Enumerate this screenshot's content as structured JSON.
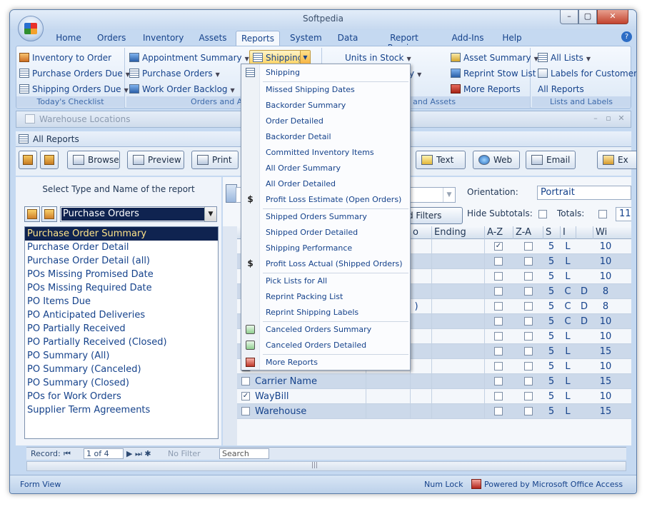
{
  "window": {
    "title": "Softpedia"
  },
  "tabs": [
    "Home",
    "Orders",
    "Inventory",
    "Assets",
    "Reports",
    "System",
    "Data",
    "Report Preview",
    "Add-Ins",
    "Help"
  ],
  "ribbon": {
    "g1": {
      "items": [
        "Inventory to Order",
        "Purchase Orders Due",
        "Shipping Orders Due"
      ],
      "label": "Today's Checklist"
    },
    "g2": {
      "items": [
        "Appointment Summary",
        "Purchase Orders",
        "Work Order Backlog"
      ],
      "label": "Orders and Appo"
    },
    "shipping_button": "Shipping",
    "g3": {
      "items": [
        "Units in Stock",
        "Asset Summary",
        "mary",
        "Reprint Stow List",
        "More Reports"
      ],
      "label": "ory and Assets"
    },
    "g4": {
      "items": [
        "All Lists",
        "Labels for Customers",
        "All Reports"
      ],
      "label": "Lists and Labels"
    }
  },
  "docwins": {
    "warehouse": "Warehouse Locations",
    "allreports": "All Reports"
  },
  "toolbar": {
    "browse": "Browse",
    "preview": "Preview",
    "print": "Print",
    "text": "Text",
    "web": "Web",
    "email": "Email",
    "exit": "Ex"
  },
  "leftpane": {
    "title": "Select Type and Name of the report",
    "selected_type": "Purchase Orders",
    "reports": [
      "Purchase Order Summary",
      "Purchase Order Detail",
      "Purchase Order Detail (all)",
      "POs Missing Promised Date",
      "POs Missing Required Date",
      "PO Items Due",
      "PO Anticipated Deliveries",
      "PO Partially Received",
      "PO Partially Received (Closed)",
      "PO Summary (All)",
      "PO Summary (Canceled)",
      "PO Summary (Closed)",
      "POs for Work Orders",
      "Supplier Term Agreements"
    ]
  },
  "options": {
    "orientation_label": "Orientation:",
    "orientation_value": "Portrait",
    "hide_subtotals_label": "Hide Subtotals:",
    "totals_label": "Totals:",
    "totals_value": "11",
    "filters_label": "d Filters"
  },
  "grid": {
    "headers": [
      "o",
      "Ending",
      "A-Z",
      "Z-A",
      "S",
      "I",
      "Wi"
    ],
    "rows": [
      {
        "name": "",
        "az": true,
        "s": "5",
        "i": "L",
        "d": "",
        "w": "10"
      },
      {
        "name": "",
        "az": false,
        "s": "5",
        "i": "L",
        "d": "",
        "w": "10"
      },
      {
        "name": "",
        "az": false,
        "s": "5",
        "i": "L",
        "d": "",
        "w": "10"
      },
      {
        "name": "",
        "az": false,
        "s": "5",
        "i": "C",
        "d": "D",
        "w": "8"
      },
      {
        "name": "",
        "extra": ")",
        "az": false,
        "s": "5",
        "i": "C",
        "d": "D",
        "w": "8"
      },
      {
        "name": "",
        "az": false,
        "s": "5",
        "i": "C",
        "d": "D",
        "w": "10"
      },
      {
        "name": "",
        "az": false,
        "s": "5",
        "i": "L",
        "d": "",
        "w": "10"
      },
      {
        "name": "",
        "az": false,
        "s": "5",
        "i": "L",
        "d": "",
        "w": "15"
      },
      {
        "name": "",
        "az": false,
        "s": "5",
        "i": "L",
        "d": "",
        "w": "10"
      },
      {
        "name": "Carrier Name",
        "checked": false,
        "az": false,
        "s": "5",
        "i": "L",
        "d": "",
        "w": "15"
      },
      {
        "name": "WayBill",
        "checked": true,
        "az": false,
        "s": "5",
        "i": "L",
        "d": "",
        "w": "10"
      },
      {
        "name": "Warehouse",
        "checked": false,
        "az": false,
        "s": "5",
        "i": "L",
        "d": "",
        "w": "15"
      }
    ]
  },
  "record": {
    "label": "Record:",
    "value": "1 of 4",
    "filter": "No Filter",
    "search": "Search"
  },
  "status": {
    "left": "Form View",
    "numlock": "Num Lock",
    "powered": "Powered by Microsoft Office Access"
  },
  "menu": {
    "items": [
      {
        "label": "Shipping",
        "icon": "report"
      },
      {
        "label": "Missed Shipping Dates",
        "icon": ""
      },
      {
        "label": "Backorder Summary",
        "icon": ""
      },
      {
        "label": "Order Detailed",
        "icon": ""
      },
      {
        "label": "Backorder Detail",
        "icon": ""
      },
      {
        "label": "Committed Inventory Items",
        "icon": ""
      },
      {
        "label": "All Order Summary",
        "icon": ""
      },
      {
        "label": "All Order Detailed",
        "icon": ""
      },
      {
        "label": "Profit Loss Estimate (Open Orders)",
        "icon": "$"
      },
      {
        "label": "Shipped Orders Summary",
        "icon": ""
      },
      {
        "label": "Shipped Order Detailed",
        "icon": ""
      },
      {
        "label": "Shipping Performance",
        "icon": ""
      },
      {
        "label": "Profit Loss Actual (Shipped Orders)",
        "icon": "$"
      },
      {
        "label": "Pick Lists for All",
        "icon": ""
      },
      {
        "label": "Reprint Packing List",
        "icon": ""
      },
      {
        "label": "Reprint Shipping Labels",
        "icon": ""
      },
      {
        "label": "Canceled Orders Summary",
        "icon": "recycle"
      },
      {
        "label": "Canceled Orders Detailed",
        "icon": "recycle"
      },
      {
        "label": "More Reports",
        "icon": "more"
      }
    ]
  }
}
